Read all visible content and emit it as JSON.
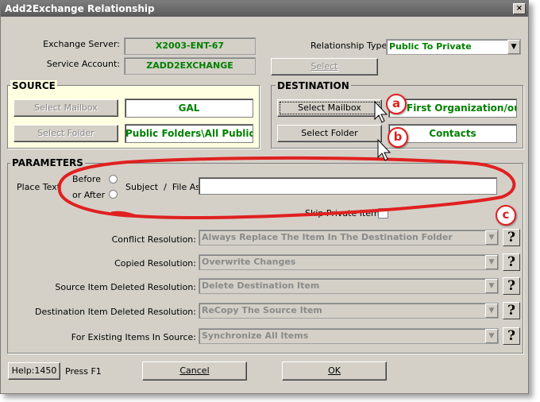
{
  "window": {
    "title": "Add2Exchange Relationship",
    "close_glyph": "×"
  },
  "server": {
    "exchange_label": "Exchange Server:",
    "exchange_value": "X2003-ENT-67",
    "account_label": "Service Account:",
    "account_value": "ZADD2EXCHANGE"
  },
  "relationship": {
    "label": "Relationship Type:",
    "value": "Public To Private",
    "select_label": "Select"
  },
  "source": {
    "title": "SOURCE",
    "mailbox_button": "Select Mailbox",
    "mailbox_value": "GAL",
    "folder_button": "Select Folder",
    "folder_value": "Public Folders\\All Public"
  },
  "destination": {
    "title": "DESTINATION",
    "mailbox_button": "Select Mailbox",
    "mailbox_value": "First Organization/ou=",
    "folder_button": "Select Folder",
    "folder_value": "Contacts"
  },
  "parameters": {
    "title": "PARAMETERS",
    "place_text_label": "Place Text",
    "before_label": "Before",
    "or_after_label": "or After",
    "subject_label": "Subject  /  File As:",
    "subject_value": "",
    "skip_private_label": "Skip Private Items",
    "rows": [
      {
        "label": "Conflict Resolution:",
        "value": "Always Replace The Item In The Destination Folder"
      },
      {
        "label": "Copied Resolution:",
        "value": "Overwrite Changes"
      },
      {
        "label": "Source Item Deleted Resolution:",
        "value": "Delete Destination Item"
      },
      {
        "label": "Destination Item Deleted Resolution:",
        "value": "ReCopy The Source Item"
      },
      {
        "label": "For Existing Items In Source:",
        "value": "Synchronize All Items"
      }
    ],
    "help_glyph": "?"
  },
  "footer": {
    "help_button": "Help:1450",
    "press_f1": "Press F1",
    "cancel_button": "Cancel",
    "ok_button": "OK"
  },
  "annotations": {
    "a": "a",
    "b": "b",
    "c": "c"
  },
  "colors": {
    "value_text": "#008000",
    "annotation": "#e02020",
    "source_background": "#ffffe1"
  }
}
